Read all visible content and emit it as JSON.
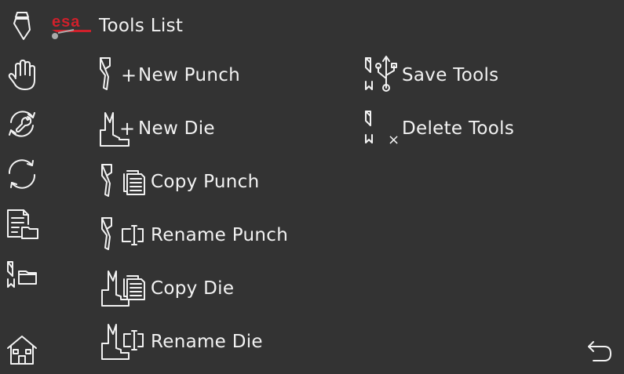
{
  "header": {
    "title": "Tools List",
    "logo_text": "esa",
    "logo_color": "#d0202b"
  },
  "sidebar": {
    "items": [
      {
        "name": "punch-tool-icon"
      },
      {
        "name": "manual-hand-icon"
      },
      {
        "name": "service-wrench-icon"
      },
      {
        "name": "cycle-refresh-icon"
      },
      {
        "name": "programs-folder-icon"
      },
      {
        "name": "tools-folder-icon"
      },
      {
        "name": "home-icon"
      }
    ]
  },
  "menu": {
    "new_punch": "New Punch",
    "new_die": "New Die",
    "copy_punch": "Copy Punch",
    "rename_punch": "Rename Punch",
    "copy_die": "Copy Die",
    "rename_die": "Rename Die",
    "save_tools": "Save Tools",
    "delete_tools": "Delete Tools"
  },
  "glyphs": {
    "plus": "+",
    "times": "×"
  },
  "colors": {
    "background": "#333333",
    "foreground": "#f2f2f2",
    "brand": "#d0202b"
  }
}
